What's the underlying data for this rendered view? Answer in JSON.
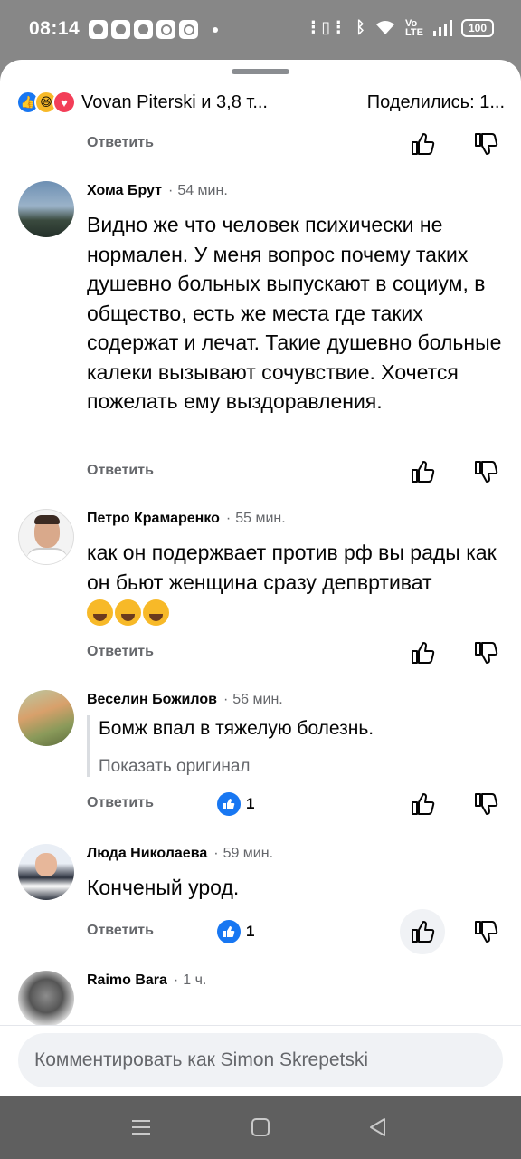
{
  "status_bar": {
    "time": "08:14",
    "battery": "100"
  },
  "header": {
    "reactions_text": "Vovan Piterski и 3,8 т...",
    "shares_text": "Поделились: 1..."
  },
  "top_reply_label": "Ответить",
  "comments": [
    {
      "name": "Хома Брут",
      "time": "54 мин.",
      "text": "Видно же что человек психически не нормален. У меня вопрос почему таких душевно больных выпускают в социум, в общество, есть же места где таких содержат и лечат. Такие душевно больные калеки  вызывают сочувствие. Хочется пожелать ему выздоравления.",
      "reply": "Ответить"
    },
    {
      "name": "Петро Крамаренко",
      "time": "55 мин.",
      "text": "как он подержвает против рф вы рады как он бьют женщина сразу депвртиват",
      "reply": "Ответить"
    },
    {
      "name": "Веселин Божилов",
      "time": "56 мин.",
      "text": "Бомж впал в тяжелую болезнь.",
      "show_original": "Показать оригинал",
      "reply": "Ответить",
      "likes": "1"
    },
    {
      "name": "Люда Николаева",
      "time": "59 мин.",
      "text": "Конченый урод.",
      "reply": "Ответить",
      "likes": "1"
    },
    {
      "name": "Raimo Bara",
      "time": "1 ч."
    }
  ],
  "composer": {
    "placeholder": "Комментировать как Simon Skrepetski"
  },
  "colors": {
    "accent": "#1877f2",
    "muted": "#65676b"
  },
  "icons": [
    "like-icon",
    "haha-icon",
    "love-icon",
    "thumb-up-icon",
    "thumb-down-icon",
    "menu-icon",
    "home-icon",
    "back-icon"
  ]
}
